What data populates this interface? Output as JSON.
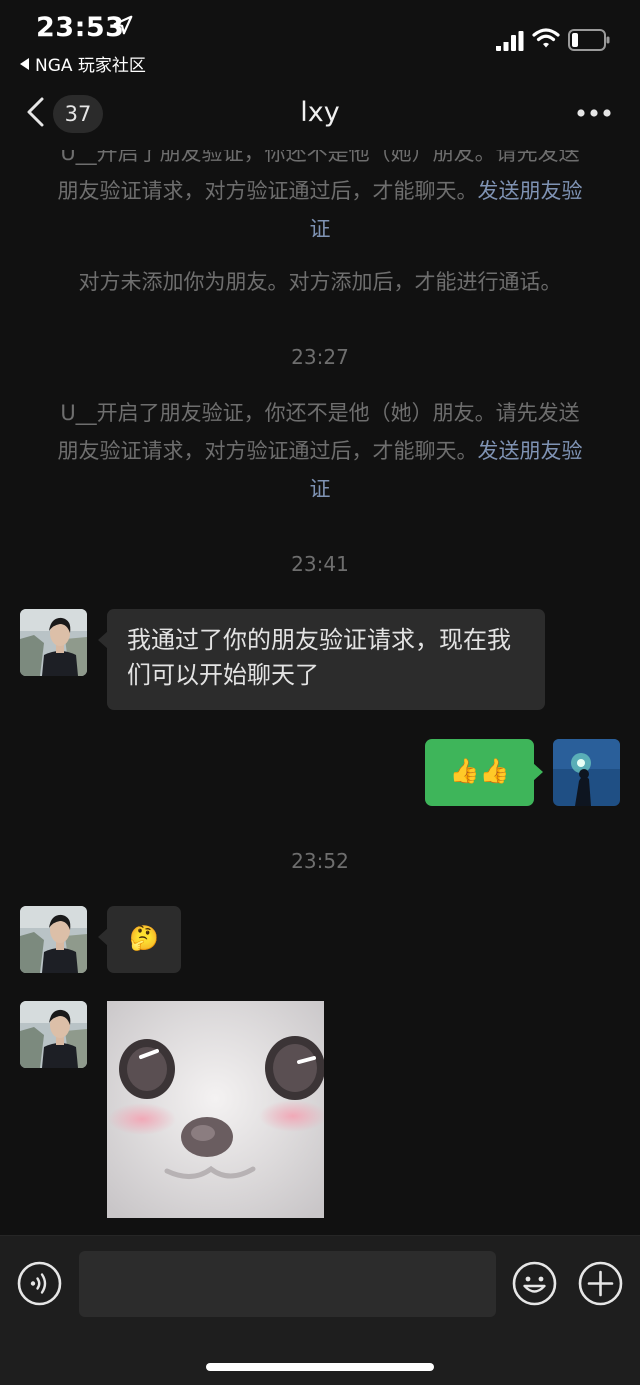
{
  "status_bar": {
    "time": "23:53",
    "back_app_label": "NGA 玩家社区",
    "battery_level": 0.2
  },
  "nav": {
    "unread_count": "37",
    "title": "lxy"
  },
  "messages": {
    "notice_1_text": "U__开启了朋友验证，你还不是他（她）朋友。请先发送朋友验证请求，对方验证通过后，才能聊天。",
    "notice_1_link": "发送朋友验证",
    "notice_2_text": "对方未添加你为朋友。对方添加后，才能进行通话。",
    "time_1": "23:27",
    "notice_3_text": "U__开启了朋友验证，你还不是他（她）朋友。请先发送朋友验证请求，对方验证通过后，才能聊天。",
    "notice_3_link": "发送朋友验证",
    "time_2": "23:41",
    "friend_msg_1": "我通过了你的朋友验证请求，现在我们可以开始聊天了",
    "my_msg_1": "👍👍",
    "time_3": "23:52",
    "friend_msg_2": "🤔"
  },
  "input": {
    "value": "",
    "placeholder": ""
  },
  "colors": {
    "background": "#111111",
    "bubble_left": "#2c2c2c",
    "bubble_right": "#3eb55a",
    "link": "#7f93b4",
    "muted_text": "#6e6e6e"
  },
  "icons": [
    "location-arrow-icon",
    "signal-icon",
    "wifi-icon",
    "battery-icon",
    "back-chevron-icon",
    "more-icon",
    "voice-icon",
    "emoji-icon",
    "plus-icon"
  ]
}
